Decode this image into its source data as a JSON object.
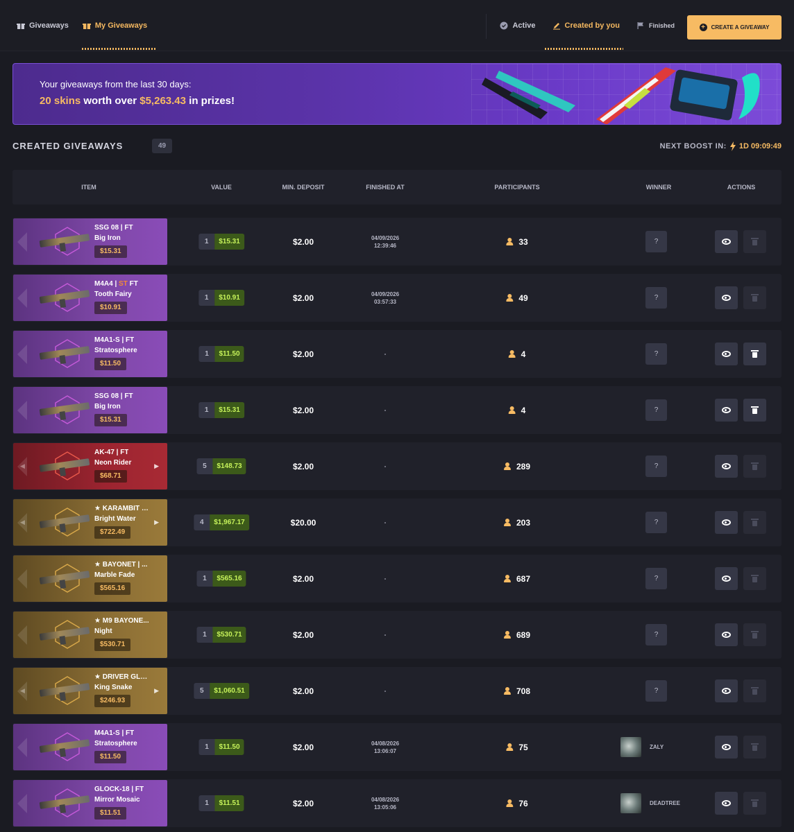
{
  "nav": {
    "left": [
      {
        "label": "Giveaways",
        "icon": "gift-icon",
        "active": false
      },
      {
        "label": "My Giveaways",
        "icon": "gift-icon",
        "active": true
      }
    ],
    "right": [
      {
        "label": "Active",
        "icon": "check-circle-icon",
        "active": false
      },
      {
        "label": "Created by you",
        "icon": "pencil-icon",
        "active": true
      },
      {
        "label": "Finished",
        "icon": "flag-icon",
        "active": false
      }
    ],
    "create_label": "CREATE A GIVEAWAY"
  },
  "banner": {
    "line1": "Your giveaways from the last 30 days:",
    "skins": "20 skins",
    "worth_text": "worth over",
    "amount": "$5,263.43",
    "suffix": "in prizes!"
  },
  "section": {
    "title": "CREATED GIVEAWAYS",
    "count": "49",
    "boost_label": "NEXT BOOST IN:",
    "boost_value": "1D 09:09:49"
  },
  "table": {
    "headers": [
      "ITEM",
      "VALUE",
      "MIN. DEPOSIT",
      "FINISHED AT",
      "PARTICIPANTS",
      "WINNER",
      "ACTIONS"
    ],
    "rows": [
      {
        "weapon": "SSG 08 |",
        "st": "",
        "wear": "FT",
        "skin": "Big Iron",
        "price": "$15.31",
        "color": "purple",
        "arrows": false,
        "qty": "1",
        "value": "$15.31",
        "deposit": "$2.00",
        "finished_date": "04/09/2026",
        "finished_time": "12:39:46",
        "participants": "33",
        "winner": "?",
        "delete_enabled": false
      },
      {
        "weapon": "M4A4 |",
        "st": "ST",
        "wear": "FT",
        "skin": "Tooth Fairy",
        "price": "$10.91",
        "color": "purple",
        "arrows": false,
        "qty": "1",
        "value": "$10.91",
        "deposit": "$2.00",
        "finished_date": "04/09/2026",
        "finished_time": "03:57:33",
        "participants": "49",
        "winner": "?",
        "delete_enabled": false
      },
      {
        "weapon": "M4A1-S |",
        "st": "",
        "wear": "FT",
        "skin": "Stratosphere",
        "price": "$11.50",
        "color": "purple",
        "arrows": false,
        "qty": "1",
        "value": "$11.50",
        "deposit": "$2.00",
        "finished_date": "-",
        "finished_time": "",
        "participants": "4",
        "winner": "?",
        "delete_enabled": true
      },
      {
        "weapon": "SSG 08 |",
        "st": "",
        "wear": "FT",
        "skin": "Big Iron",
        "price": "$15.31",
        "color": "purple",
        "arrows": false,
        "qty": "1",
        "value": "$15.31",
        "deposit": "$2.00",
        "finished_date": "-",
        "finished_time": "",
        "participants": "4",
        "winner": "?",
        "delete_enabled": true
      },
      {
        "weapon": "AK-47 |",
        "st": "",
        "wear": "FT",
        "skin": "Neon Rider",
        "price": "$68.71",
        "color": "red",
        "arrows": true,
        "qty": "5",
        "value": "$148.73",
        "deposit": "$2.00",
        "finished_date": "-",
        "finished_time": "",
        "participants": "289",
        "winner": "?",
        "delete_enabled": false
      },
      {
        "weapon": "★ KARAMBIT | ...",
        "st": "",
        "wear": "",
        "skin": "Bright Water",
        "price": "$722.49",
        "color": "gold",
        "arrows": true,
        "qty": "4",
        "value": "$1,967.17",
        "deposit": "$20.00",
        "finished_date": "-",
        "finished_time": "",
        "participants": "203",
        "winner": "?",
        "delete_enabled": false
      },
      {
        "weapon": "★ BAYONET | ...",
        "st": "",
        "wear": "",
        "skin": "Marble Fade",
        "price": "$565.16",
        "color": "gold",
        "arrows": false,
        "qty": "1",
        "value": "$565.16",
        "deposit": "$2.00",
        "finished_date": "-",
        "finished_time": "",
        "participants": "687",
        "winner": "?",
        "delete_enabled": false
      },
      {
        "weapon": "★ M9 BAYONE...",
        "st": "",
        "wear": "",
        "skin": "Night",
        "price": "$530.71",
        "color": "gold",
        "arrows": false,
        "qty": "1",
        "value": "$530.71",
        "deposit": "$2.00",
        "finished_date": "-",
        "finished_time": "",
        "participants": "689",
        "winner": "?",
        "delete_enabled": false
      },
      {
        "weapon": "★ DRIVER GLO...",
        "st": "",
        "wear": "",
        "skin": "King Snake",
        "price": "$246.93",
        "color": "gold",
        "arrows": true,
        "qty": "5",
        "value": "$1,060.51",
        "deposit": "$2.00",
        "finished_date": "-",
        "finished_time": "",
        "participants": "708",
        "winner": "?",
        "delete_enabled": false
      },
      {
        "weapon": "M4A1-S |",
        "st": "",
        "wear": "FT",
        "skin": "Stratosphere",
        "price": "$11.50",
        "color": "purple",
        "arrows": false,
        "qty": "1",
        "value": "$11.50",
        "deposit": "$2.00",
        "finished_date": "04/08/2026",
        "finished_time": "13:06:07",
        "participants": "75",
        "winner": "ZALY",
        "delete_enabled": false
      },
      {
        "weapon": "GLOCK-18 |",
        "st": "",
        "wear": "FT",
        "skin": "Mirror Mosaic",
        "price": "$11.51",
        "color": "purple",
        "arrows": false,
        "qty": "1",
        "value": "$11.51",
        "deposit": "$2.00",
        "finished_date": "04/08/2026",
        "finished_time": "13:05:06",
        "participants": "76",
        "winner": "DEADTREE",
        "delete_enabled": false
      }
    ]
  }
}
